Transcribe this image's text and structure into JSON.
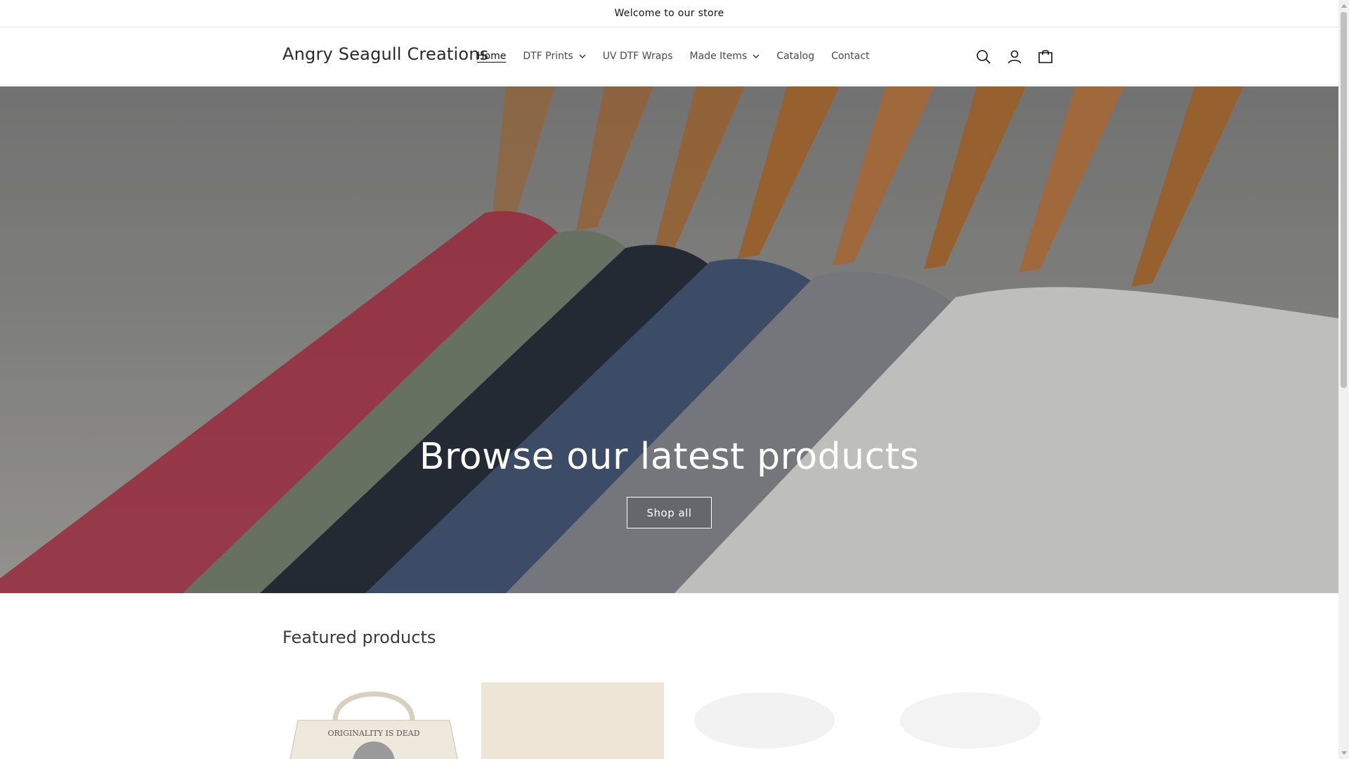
{
  "announcement": {
    "text": "Welcome to our store"
  },
  "header": {
    "logo": "Angry Seagull Creations",
    "nav": [
      {
        "label": "Home",
        "active": true,
        "has_dropdown": false
      },
      {
        "label": "DTF Prints",
        "active": false,
        "has_dropdown": true
      },
      {
        "label": "UV DTF Wraps",
        "active": false,
        "has_dropdown": false
      },
      {
        "label": "Made Items",
        "active": false,
        "has_dropdown": true
      },
      {
        "label": "Catalog",
        "active": false,
        "has_dropdown": false
      },
      {
        "label": "Contact",
        "active": false,
        "has_dropdown": false
      }
    ],
    "icons": [
      "search-icon",
      "account-icon",
      "cart-icon"
    ]
  },
  "hero": {
    "title": "Browse our latest products",
    "button_label": "Shop all"
  },
  "featured": {
    "title": "Featured products",
    "products": [
      {
        "image_text": "ORIGINALITY IS DEAD"
      },
      {
        "image_text": ""
      },
      {
        "image_text": ""
      },
      {
        "image_text": ""
      }
    ]
  },
  "colors": {
    "text": "#121212",
    "hanger_wood": "#b8763a",
    "shirt_red": "#b8344a",
    "shirt_green": "#7d8a78",
    "shirt_navy": "#2d3440",
    "shirt_blue": "#4b5d7d",
    "shirt_gray": "#8e9198",
    "shirt_white": "#e8e8e6"
  }
}
